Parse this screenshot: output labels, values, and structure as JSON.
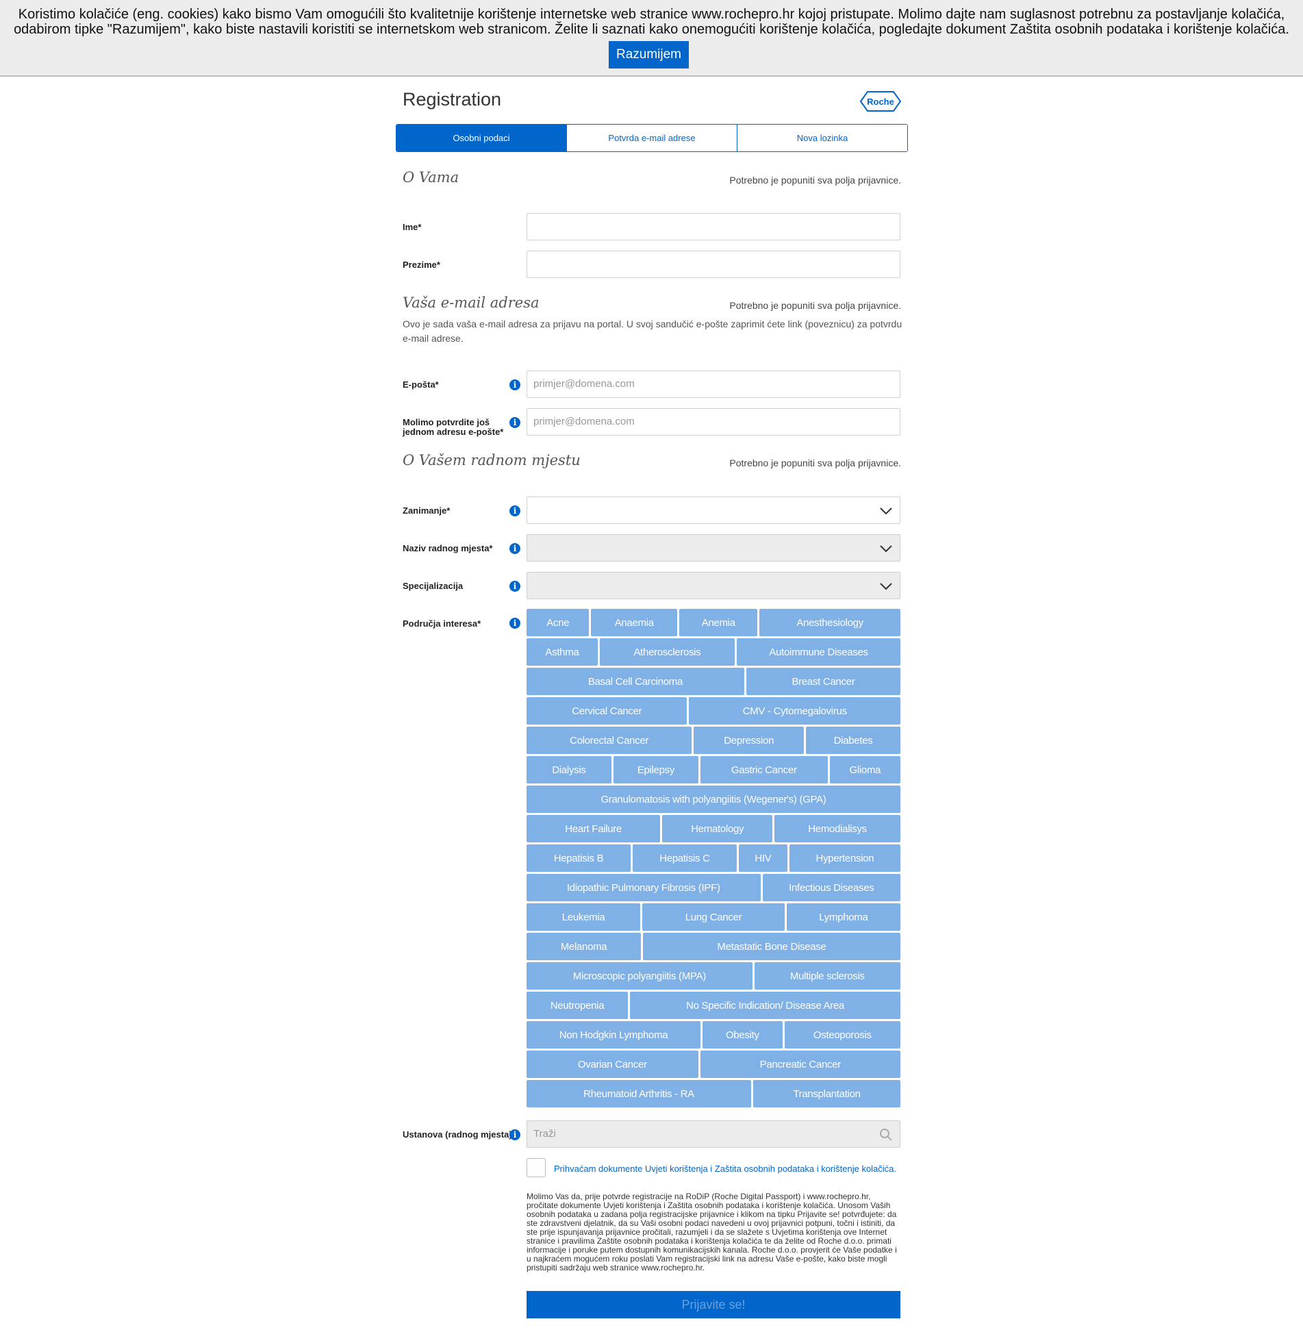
{
  "cookie_banner": {
    "text": "Koristimo kolačiće (eng. cookies) kako bismo Vam omogućili što kvalitetnije korištenje internetske web stranice www.rochepro.hr kojoj pristupate. Molimo dajte nam suglasnost potrebnu za postavljanje kolačića, odabirom tipke \"Razumijem\", kako biste nastavili koristiti se internetskom web stranicom. Želite li saznati kako onemogućiti korištenje kolačića, pogledajte dokument Zaštita osobnih podataka i korištenje kolačića.",
    "button_label": "Razumijem"
  },
  "header": {
    "title": "Registration",
    "logo_text": "Roche"
  },
  "steps": [
    {
      "label": "Osobni podaci",
      "active": true
    },
    {
      "label": "Potvrda e-mail adrese",
      "active": false
    },
    {
      "label": "Nova lozinka",
      "active": false
    }
  ],
  "section_about": {
    "title": "O Vama",
    "note": "Potrebno je popuniti sva polja prijavnice.",
    "ime_label": "Ime*",
    "prezime_label": "Prezime*"
  },
  "section_email": {
    "title": "Vaša e-mail adresa",
    "note": "Potrebno je popuniti sva polja prijavnice.",
    "description": "Ovo je sada vaša e-mail adresa za prijavu na portal. U svoj sandučić e-pošte zaprimit ćete link (poveznicu) za potvrdu e-mail adrese.",
    "email_label": "E-pošta*",
    "email_placeholder": "primjer@domena.com",
    "confirm_label": "Molimo potvrdite još jednom adresu e-pošte*",
    "confirm_placeholder": "primjer@domena.com"
  },
  "section_work": {
    "title": "O Vašem radnom mjestu",
    "note": "Potrebno je popuniti sva polja prijavnice.",
    "zanimanje_label": "Zanimanje*",
    "naziv_label": "Naziv radnog mjesta*",
    "specijalizacija_label": "Specijalizacija",
    "interests_label": "Područja interesa*",
    "ustanova_label": "Ustanova (radnog mjesta)*",
    "search_placeholder": "Traži"
  },
  "interest_rows": [
    [
      "Acne",
      "Anaemia",
      "Anemia",
      "Anesthesiology"
    ],
    [
      "Asthma",
      "Atherosclerosis",
      "Autoimmune Diseases"
    ],
    [
      "Basal Cell Carcinoma",
      "Breast Cancer"
    ],
    [
      "Cervical Cancer",
      "CMV - Cytomegalovirus"
    ],
    [
      "Colorectal Cancer",
      "Depression",
      "Diabetes"
    ],
    [
      "Dialysis",
      "Epilepsy",
      "Gastric Cancer",
      "Glioma"
    ],
    [
      "Granulomatosis with polyangiitis (Wegener's) (GPA)"
    ],
    [
      "Heart Failure",
      "Hematology",
      "Hemodialisys"
    ],
    [
      "Hepatisis B",
      "Hepatisis C",
      "HIV",
      "Hypertension"
    ],
    [
      "Idiopathic Pulmonary Fibrosis (IPF)",
      "Infectious Diseases"
    ],
    [
      "Leukemia",
      "Lung Cancer",
      "Lymphoma"
    ],
    [
      "Melanoma",
      "Metastatic Bone Disease"
    ],
    [
      "Microscopic polyangiitis (MPA)",
      "Multiple sclerosis"
    ],
    [
      "Neutropenia",
      "No Specific Indication/ Disease Area"
    ],
    [
      "Non Hodgkin Lymphoma",
      "Obesity",
      "Osteoporosis"
    ],
    [
      "Ovarian Cancer",
      "Pancreatic Cancer"
    ],
    [
      "Rheumatoid Arthritis - RA",
      "Transplantation"
    ]
  ],
  "consent": {
    "checkbox_label": "Prihvaćam dokumente Uvjeti korištenja i Zaštita osobnih podataka i korištenje kolačića.",
    "legal_text": "Molimo Vas da, prije potvrde registracije na RoDiP (Roche Digital Passport) i www.rochepro.hr, pročitate dokumente Uvjeti korištenja i Zaštita osobnih podataka i korištenje kolačića. Unosom Vaših osobnih podataka u zadana polja registracijske prijavnice i klikom na tipku Prijavite se! potvrđujete: da ste zdravstveni djelatnik, da su Vaši osobni podaci navedeni u ovoj prijavnici potpuni, točni i istiniti, da ste prije ispunjavanja prijavnice pročitali, razumjeli i da se slažete s Uvjetima korištenja ove Internet stranice i pravilima Zaštite osobnih podataka i korištenja kolačića te da želite od Roche d.o.o. primati informacije i poruke putem dostupnih komunikacijskih kanala. Roche d.o.o. provjerit će Vaše podatke i u najkraćem mogućem roku poslati Vam registracijski link na adresu Vaše e-pošte, kako biste mogli pristupiti sadržaju web stranice www.rochepro.hr."
  },
  "submit_label": "Prijavite se!",
  "colors": {
    "primary": "#0066cc",
    "tag": "#7fb0e6",
    "banner_bg": "#ececec"
  }
}
